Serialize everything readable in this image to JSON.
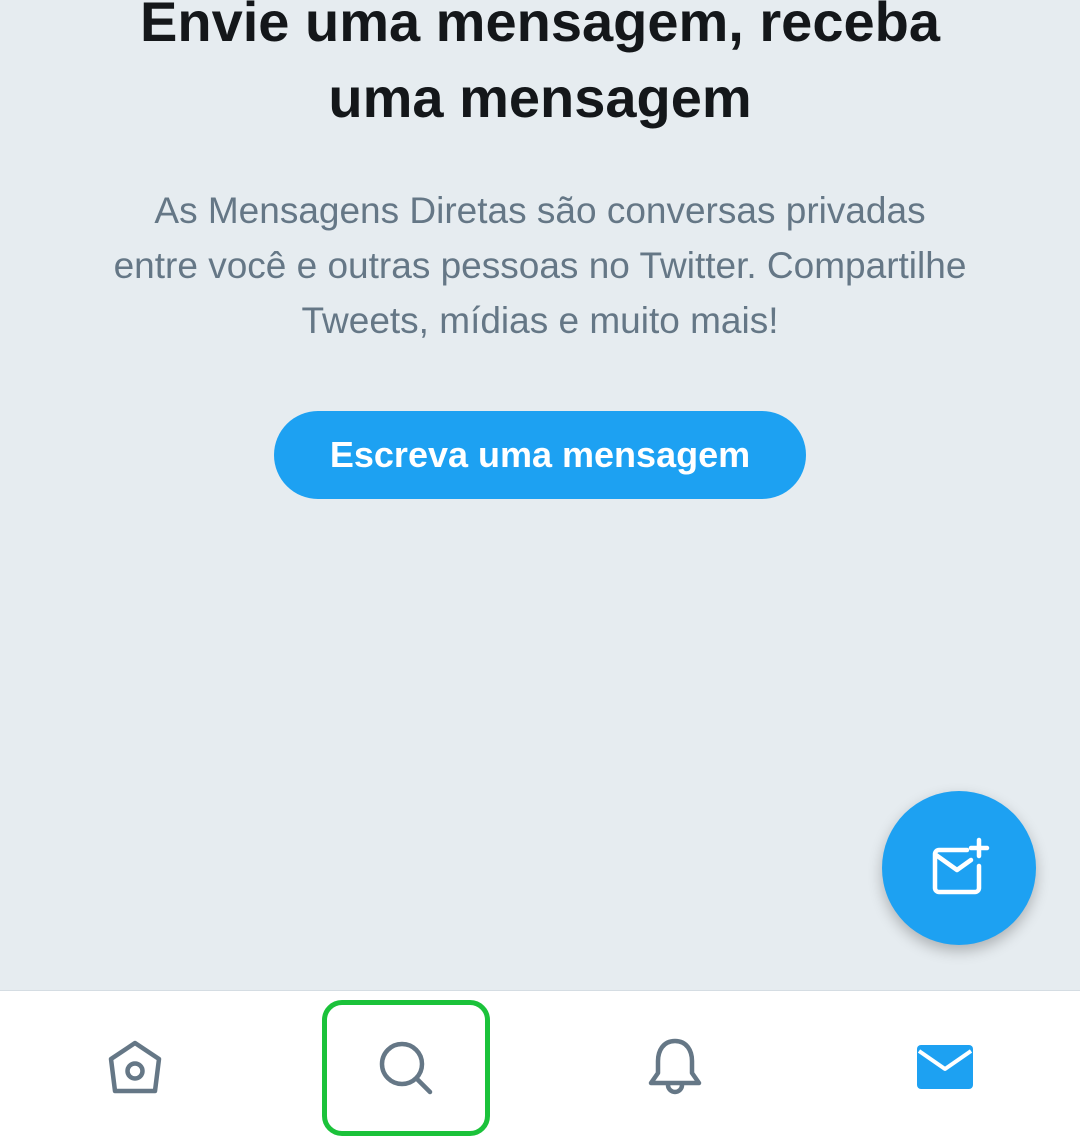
{
  "empty_state": {
    "title_line1": "Envie uma mensagem, receba",
    "title_line2": "uma mensagem",
    "desc_line1": "As Mensagens Diretas são conversas privadas",
    "desc_line2": "entre você e outras pessoas no Twitter. Compartilhe",
    "desc_line3": "Tweets, mídias e muito mais!",
    "cta_label": "Escreva uma mensagem"
  },
  "fab": {
    "icon": "new-message-icon"
  },
  "bottom_nav": {
    "items": [
      {
        "icon": "home-icon",
        "active": false
      },
      {
        "icon": "search-icon",
        "active": false,
        "highlighted": true
      },
      {
        "icon": "bell-icon",
        "active": false
      },
      {
        "icon": "mail-icon",
        "active": true
      }
    ]
  },
  "colors": {
    "accent": "#1da1f2",
    "background": "#e6ecf0",
    "title_text": "#14171a",
    "secondary_text": "#657786",
    "highlight_border": "#1bc23a"
  }
}
